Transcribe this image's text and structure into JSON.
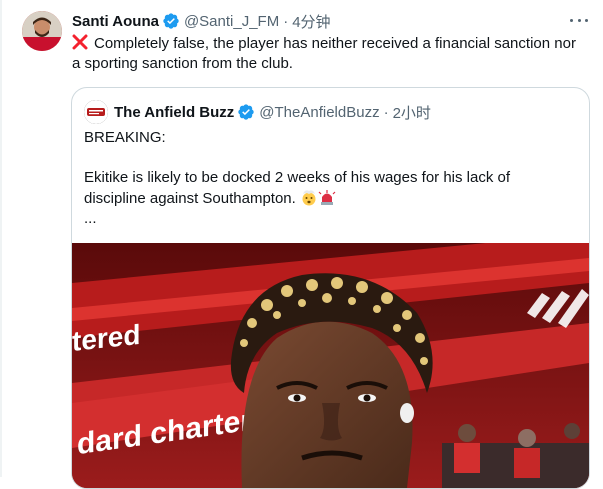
{
  "tweet": {
    "author_name": "Santi Aouna",
    "handle": "@Santi_J_FM",
    "separator": "·",
    "time": "4分钟",
    "text": "Completely false, the player has neither received a financial sanction nor a sporting sanction from the club.",
    "icons": [
      "cross-mark-icon",
      "verified-badge-icon",
      "more-icon"
    ]
  },
  "quote": {
    "author_name": "The Anfield Buzz",
    "handle": "@TheAnfieldBuzz",
    "separator": "·",
    "time": "2小时",
    "line1": "BREAKING:",
    "line2": "Ekitike is likely to be docked 2 weeks of his wages for his lack of discipline against Southampton.",
    "ellipsis": "...",
    "image_text": {
      "left_banner_top": "tered",
      "left_banner_bottom": "dard charter"
    },
    "emojis": [
      "exploding-head-icon",
      "siren-icon"
    ]
  },
  "colors": {
    "text": "#0f1419",
    "secondary": "#536471",
    "verified": "#1d9bf0",
    "border": "#cfd9de",
    "cross": "#f4212e"
  }
}
